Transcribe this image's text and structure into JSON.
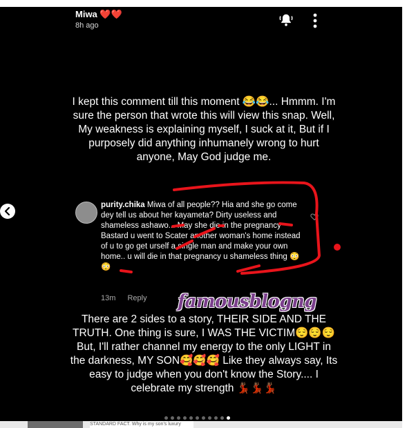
{
  "header": {
    "username": "Miwa",
    "emoji": "❤️❤️",
    "time": "8h ago"
  },
  "caption_top": "I kept this comment till this moment 😂😂... Hmmm. I'm sure the person that wrote this will view this snap. Well, My weakness is explaining myself, I suck at it, But if I purposely did anything inhumanely wrong to hurt anyone, May God judge me.",
  "comment": {
    "user": "purity.chika",
    "text": "Miwa of all people?? Hia and she go come dey tell us about her kayameta? Dirty useless and shameless ashawo... May she die in the pregnancy Bastard u went to Scater another woman's home instead of u to go get urself a single man and make your own home.. u will die in that pregnancy u shameless thing 😳😳",
    "age": "13m",
    "reply": "Reply"
  },
  "watermark": "famousblogng",
  "caption_bottom": "There are 2 sides to a story, THEIR SIDE AND THE TRUTH. One thing is sure, I WAS THE VICTIM😌😌😌 But, I'll rather channel my energy to the only LIGHT in the darkness, MY SON🥰🥰🥰 Like they always say, Its easy to judge when you don't know the Story.... I celebrate my strength 💃🏾💃🏾💃🏾",
  "bottom_snippet": "STANDARD FACT. Why is my son's luxury lifestyle pissing you off. Its not my fault God",
  "colors": {
    "annotation_red": "#e8141b",
    "watermark": "#7b3f8c"
  }
}
